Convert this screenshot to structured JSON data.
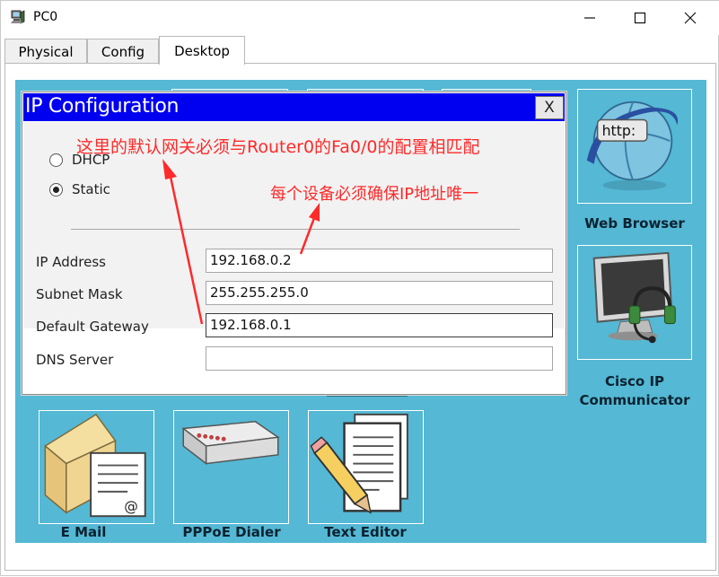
{
  "window": {
    "title": "PC0",
    "icons": {
      "app": "pc-icon",
      "minimize": "minimize-icon",
      "maximize": "maximize-icon",
      "close": "close-icon"
    }
  },
  "tabs": [
    {
      "label": "Physical",
      "active": false
    },
    {
      "label": "Config",
      "active": false
    },
    {
      "label": "Desktop",
      "active": true
    }
  ],
  "desktop": {
    "background": "#55b8d4",
    "apps": [
      {
        "label": "Web Browser",
        "icon": "web-browser-icon"
      },
      {
        "label": "Cisco IP\nCommunicator",
        "icon": "cisco-ip-communicator-icon"
      },
      {
        "label": "E Mail",
        "icon": "email-icon"
      },
      {
        "label": "PPPoE Dialer",
        "icon": "pppoe-dialer-icon"
      },
      {
        "label": "Text Editor",
        "icon": "text-editor-icon"
      }
    ]
  },
  "dialog": {
    "title": "IP Configuration",
    "close_label": "X",
    "header_color": "#0000f0",
    "mode_options": [
      {
        "label": "DHCP",
        "selected": false
      },
      {
        "label": "Static",
        "selected": true
      }
    ],
    "fields": [
      {
        "label": "IP Address",
        "value": "192.168.0.2"
      },
      {
        "label": "Subnet Mask",
        "value": "255.255.255.0"
      },
      {
        "label": "Default Gateway",
        "value": "192.168.0.1"
      },
      {
        "label": "DNS Server",
        "value": ""
      }
    ]
  },
  "annotations": {
    "gateway_note": "这里的默认网关必须与Router0的Fa0/0的配置相匹配",
    "ip_note": "每个设备必须确保IP地址唯一",
    "color": "#ff2a2a"
  }
}
